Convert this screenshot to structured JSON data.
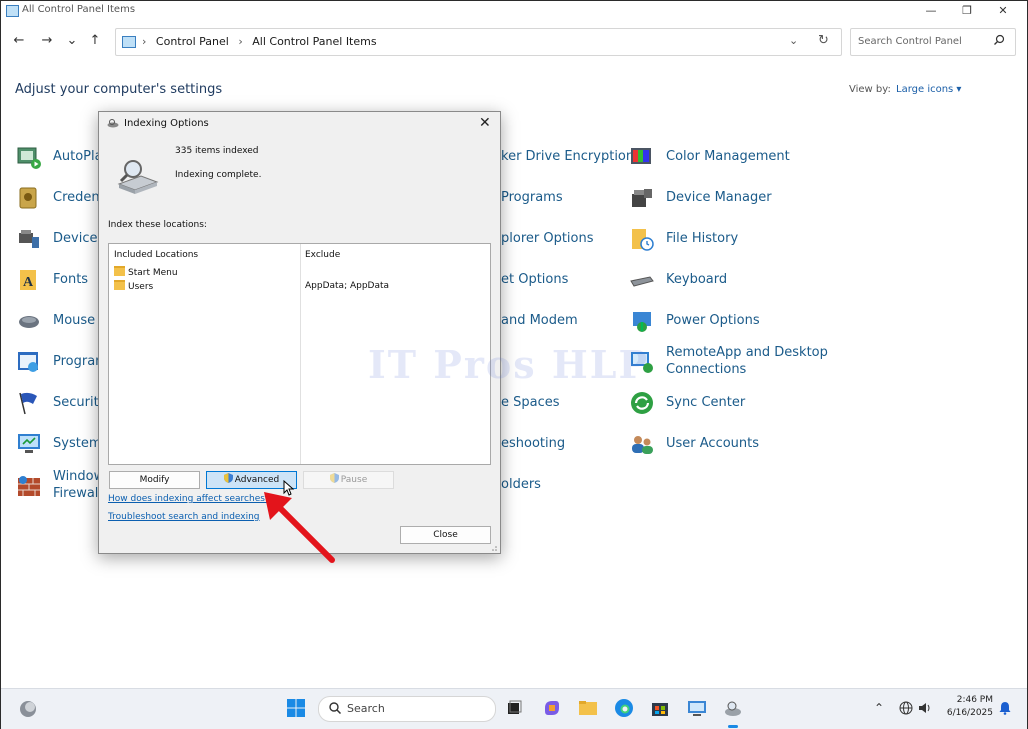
{
  "window": {
    "title": "All Control Panel Items",
    "controls": {
      "minimize": "—",
      "maximize": "❐",
      "close": "✕"
    }
  },
  "nav": {
    "back": "←",
    "forward": "→",
    "recent": "⌄",
    "up": "↑"
  },
  "address": {
    "crumb_sep": "›",
    "crumbs": [
      "Control Panel",
      "All Control Panel Items"
    ],
    "dropdown": "⌄",
    "refresh": "↻"
  },
  "search": {
    "placeholder": "Search Control Panel",
    "icon": "search-icon"
  },
  "main": {
    "heading": "Adjust your computer's settings",
    "view_by_label": "View by:",
    "view_by_value": "Large icons ▾"
  },
  "items_col1": [
    {
      "label": "AutoPlay",
      "icon": "autoplay-icon"
    },
    {
      "label": "Credenti",
      "icon": "credential-icon"
    },
    {
      "label": "Devices",
      "icon": "devices-icon"
    },
    {
      "label": "Fonts",
      "icon": "fonts-icon"
    },
    {
      "label": "Mouse",
      "icon": "mouse-icon"
    },
    {
      "label": "Program",
      "icon": "programs-icon"
    },
    {
      "label": "Security",
      "icon": "security-flag-icon"
    },
    {
      "label": "System",
      "icon": "system-icon"
    },
    {
      "label": "Window\nFirewall",
      "icon": "firewall-icon"
    }
  ],
  "items_col2": [
    {
      "label": "ker Drive Encryption"
    },
    {
      "label": "Programs"
    },
    {
      "label": "plorer Options"
    },
    {
      "label": "et Options"
    },
    {
      "label": "and Modem"
    },
    {
      "label": "e Spaces"
    },
    {
      "label": "eshooting"
    },
    {
      "label": "olders"
    }
  ],
  "items_col3": [
    {
      "label": "Color Management",
      "icon": "color-management-icon"
    },
    {
      "label": "Device Manager",
      "icon": "device-manager-icon"
    },
    {
      "label": "File History",
      "icon": "file-history-icon"
    },
    {
      "label": "Keyboard",
      "icon": "keyboard-icon"
    },
    {
      "label": "Power Options",
      "icon": "power-options-icon"
    },
    {
      "label": "RemoteApp and Desktop\nConnections",
      "icon": "remoteapp-icon"
    },
    {
      "label": "Sync Center",
      "icon": "sync-center-icon"
    },
    {
      "label": "User Accounts",
      "icon": "user-accounts-icon"
    }
  ],
  "dialog": {
    "title": "Indexing Options",
    "close": "✕",
    "items_indexed": "335 items indexed",
    "status": "Indexing complete.",
    "index_label": "Index these locations:",
    "col_included": "Included Locations",
    "col_exclude": "Exclude",
    "locations": [
      {
        "name": "Start Menu",
        "exclude": ""
      },
      {
        "name": "Users",
        "exclude": "AppData; AppData"
      }
    ],
    "buttons": {
      "modify": "Modify",
      "advanced": "Advanced",
      "pause": "Pause"
    },
    "link1": "How does indexing affect searches?",
    "link2": "Troubleshoot search and indexing",
    "close_button": "Close"
  },
  "watermark": "IT Pros HLP",
  "taskbar": {
    "search_text": "Search",
    "time": "2:46 PM",
    "date": "6/16/2025"
  },
  "colors": {
    "link": "#1b5b8a",
    "accent": "#0078d4",
    "arrow": "#e3141b"
  }
}
